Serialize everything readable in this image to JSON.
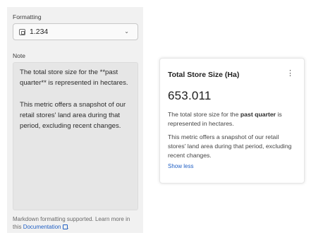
{
  "editor": {
    "formatting_label": "Formatting",
    "formatting_value": "1.234",
    "note_label": "Note",
    "note_paragraph1": "The total store size for the **past quarter** is represented in hectares.",
    "note_paragraph2": "This metric offers a snapshot of our retail stores' land area during that period, excluding recent changes.",
    "helper_text": "Markdown formatting supported. Learn more in this",
    "helper_link": "Documentation",
    "helper_suffix": "."
  },
  "card": {
    "title": "Total Store Size (Ha)",
    "value": "653.011",
    "desc1_pre": "The total store size for the",
    "desc1_bold": "past quarter",
    "desc1_post": "is represented in hectares.",
    "desc2": "This metric offers a snapshot of our retail stores' land area during that period, excluding recent changes.",
    "show_less": "Show less"
  },
  "icons": {
    "format": "number-format-icon",
    "dropdown": "chevron-down-icon",
    "menu": "kebab-menu-icon",
    "external": "external-link-icon"
  },
  "colors": {
    "panel_bg": "#f1f1f1",
    "link": "#2160c4"
  }
}
